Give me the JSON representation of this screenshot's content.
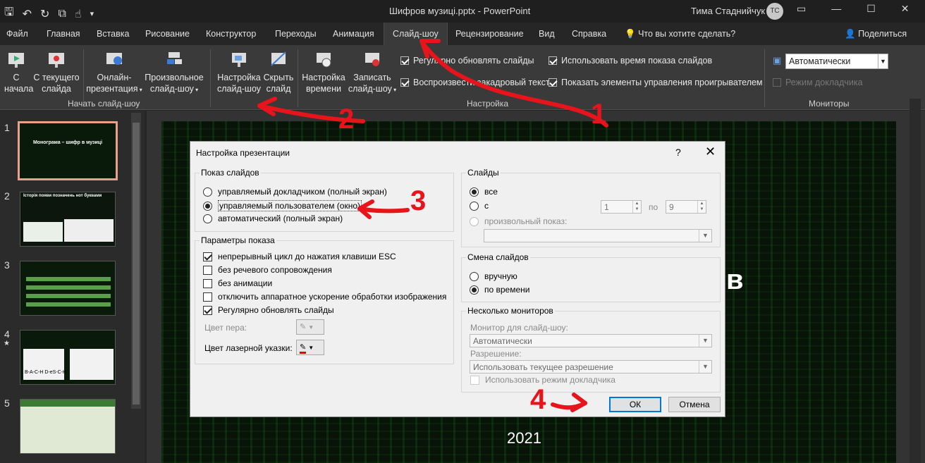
{
  "window": {
    "title": "Шифров музиці.pptx  -  PowerPoint",
    "user": "Тима Стаднийчук",
    "initials": "TC"
  },
  "tabs": [
    "Файл",
    "Главная",
    "Вставка",
    "Рисование",
    "Конструктор",
    "Переходы",
    "Анимация",
    "Слайд-шоу",
    "Рецензирование",
    "Вид",
    "Справка"
  ],
  "active_tab": "Слайд-шоу",
  "tell_me": "Что вы хотите сделать?",
  "share": "Поделиться",
  "ribbon": {
    "from_start": "С\nначала",
    "from_current": "С текущего\nслайда",
    "online": "Онлайн-\nпрезентация",
    "custom": "Произвольное\nслайд-шоу",
    "group_start": "Начать слайд-шоу",
    "setup": "Настройка\nслайд-шоу",
    "hide": "Скрыть\nслайд",
    "timing": "Настройка\nвремени",
    "record": "Записать\nслайд-шоу",
    "chk_update": "Регулярно обновлять слайды",
    "chk_narr": "Воспроизвести закадровый текст",
    "chk_timings": "Использовать время показа слайдов",
    "chk_controls": "Показать элементы управления проигрывателем",
    "group_setup": "Настройка",
    "monitor_value": "Автоматически",
    "presenter": "Режим докладчика",
    "group_monitors": "Мониторы"
  },
  "thumbnails": [
    {
      "num": "1",
      "title": "Монограма – шифр в музиці"
    },
    {
      "num": "2",
      "title": "Історія появи позначень нот буквами"
    },
    {
      "num": "3",
      "title": ""
    },
    {
      "num": "4",
      "title": "B-A-C-H  D-eS-C-H"
    },
    {
      "num": "5",
      "title": ""
    }
  ],
  "slide": {
    "year": "2021",
    "partial": "в"
  },
  "dialog": {
    "title": "Настройка презентации",
    "help": "?",
    "close": "✕",
    "show_type": {
      "legend": "Показ слайдов",
      "opt1": "управляемый докладчиком (полный экран)",
      "opt2": "управляемый пользователем (окно)",
      "opt3": "автоматический (полный экран)"
    },
    "options": {
      "legend": "Параметры показа",
      "loop": "непрерывный цикл до нажатия клавиши ESC",
      "no_narr": "без речевого сопровождения",
      "no_anim": "без анимации",
      "no_hw": "отключить аппаратное ускорение обработки изображения",
      "update": "Регулярно обновлять слайды",
      "pen": "Цвет пера:",
      "laser": "Цвет лазерной указки:"
    },
    "slides": {
      "legend": "Слайды",
      "all": "все",
      "from": "с",
      "from_val": "1",
      "to": "по",
      "to_val": "9",
      "custom": "произвольный показ:"
    },
    "advance": {
      "legend": "Смена слайдов",
      "manual": "вручную",
      "timings": "по времени"
    },
    "monitors": {
      "legend": "Несколько мониторов",
      "monitor_label": "Монитор для слайд-шоу:",
      "monitor_value": "Автоматически",
      "resolution_label": "Разрешение:",
      "resolution_value": "Использовать текущее разрешение",
      "presenter": "Использовать режим докладчика"
    },
    "ok": "ОК",
    "cancel": "Отмена"
  },
  "annotations": [
    "1",
    "2",
    "3",
    "4"
  ],
  "colors": {
    "accent": "#0078d7",
    "annotation": "#e8141c"
  }
}
